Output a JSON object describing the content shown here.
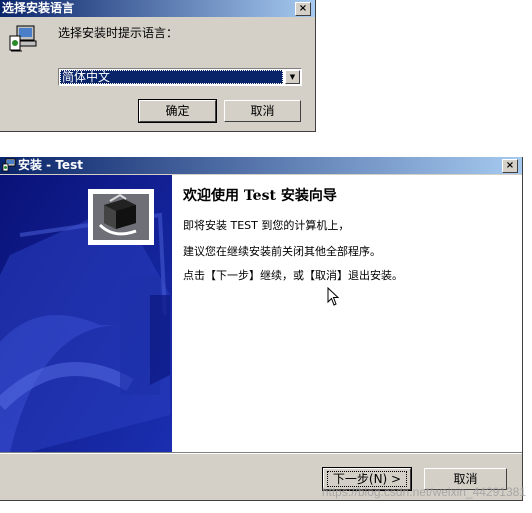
{
  "lang_dialog": {
    "title": "选择安装语言",
    "close_glyph": "×",
    "prompt": "选择安装时提示语言：",
    "selected_language": "简体中文",
    "dropdown_glyph": "▼",
    "ok_label": "确定",
    "cancel_label": "取消"
  },
  "wizard": {
    "title": "安装 - Test",
    "min_glyph": "_",
    "max_glyph": "□",
    "close_glyph": "×",
    "heading": "欢迎使用 Test 安装向导",
    "line1": "即将安装 TEST 到您的计算机上，",
    "line2": "建议您在继续安装前关闭其他全部程序。",
    "line3": "点击【下一步】继续，或【取消】退出安装。",
    "next_label": "下一步(N) >",
    "cancel_label": "取消"
  },
  "watermark": "https://blog.csdn.net/weixin_44291381",
  "colors": {
    "titlebar_start": "#0a246a",
    "titlebar_end": "#a6caf0",
    "face": "#d4d0c8",
    "sidebar": "#0a1a8a"
  },
  "icons": [
    "setup-computer-icon",
    "setup-titlebar-icon",
    "wizard-box-icon",
    "mouse-cursor-icon"
  ]
}
